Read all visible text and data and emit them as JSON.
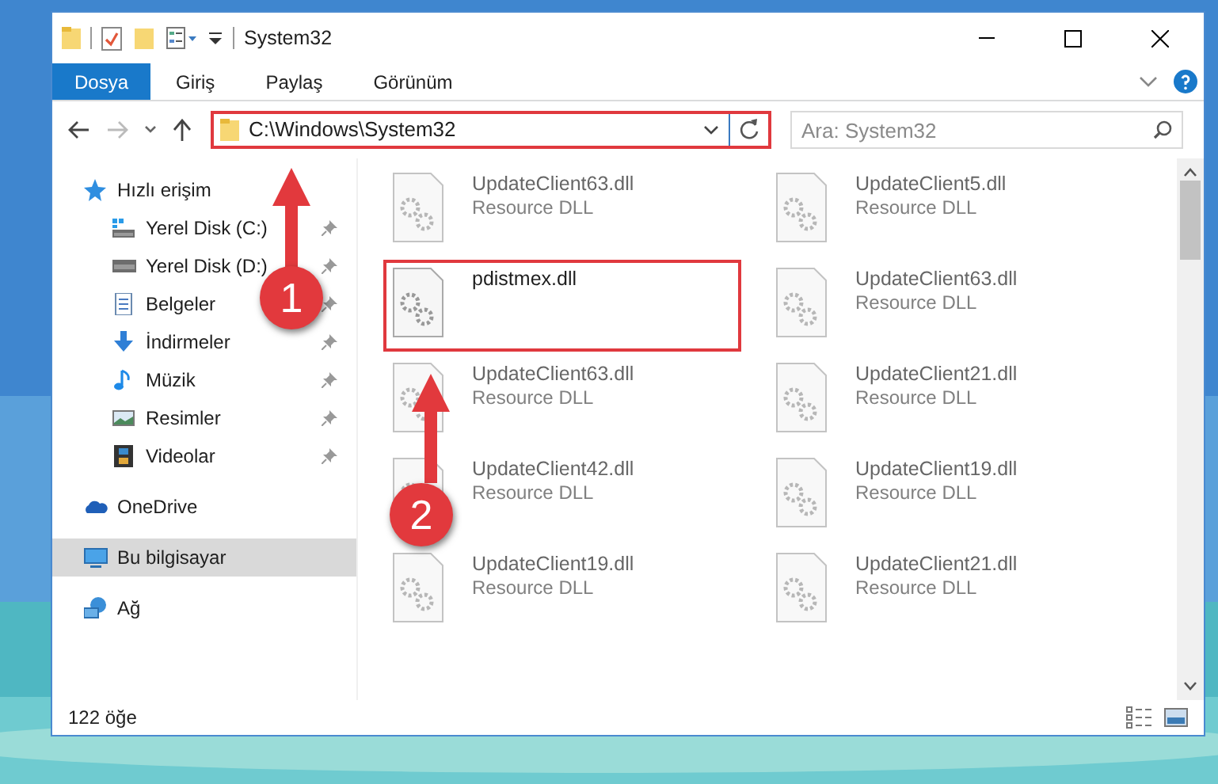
{
  "window": {
    "title": "System32"
  },
  "ribbon_tabs": [
    {
      "label": "Dosya",
      "selected": true
    },
    {
      "label": "Giriş",
      "selected": false
    },
    {
      "label": "Paylaş",
      "selected": false
    },
    {
      "label": "Görünüm",
      "selected": false
    }
  ],
  "address_bar": {
    "path": "C:\\Windows\\System32",
    "highlighted": true
  },
  "search": {
    "placeholder": "Ara: System32"
  },
  "navigation": [
    {
      "label": "Hızlı erişim",
      "kind": "star",
      "selected": false,
      "children": [
        {
          "label": "Yerel Disk (C:)",
          "kind": "system-drive",
          "pinned": true,
          "selected": false
        },
        {
          "label": "Yerel Disk (D:)",
          "kind": "drive",
          "pinned": true,
          "selected": false
        },
        {
          "label": "Belgeler",
          "kind": "documents",
          "pinned": true,
          "selected": false
        },
        {
          "label": "İndirmeler",
          "kind": "downloads",
          "pinned": true,
          "selected": false
        },
        {
          "label": "Müzik",
          "kind": "music",
          "pinned": true,
          "selected": false
        },
        {
          "label": "Resimler",
          "kind": "pictures",
          "pinned": true,
          "selected": false
        },
        {
          "label": "Videolar",
          "kind": "videos",
          "pinned": true,
          "selected": false
        }
      ]
    },
    {
      "label": "OneDrive",
      "kind": "cloud",
      "selected": false
    },
    {
      "label": "Bu bilgisayar",
      "kind": "computer",
      "selected": true
    },
    {
      "label": "Ağ",
      "kind": "network",
      "selected": false
    }
  ],
  "files": [
    {
      "name": "UpdateClient63.dll",
      "type": "Resource DLL",
      "dimmed": true,
      "highlighted": false
    },
    {
      "name": "UpdateClient5.dll",
      "type": "Resource DLL",
      "dimmed": true,
      "highlighted": false
    },
    {
      "name": "pdistmex.dll",
      "dimmed": false,
      "highlighted": true
    },
    {
      "name": "UpdateClient63.dll",
      "type": "Resource DLL",
      "dimmed": true,
      "highlighted": false
    },
    {
      "name": "UpdateClient63.dll",
      "type": "Resource DLL",
      "dimmed": true,
      "highlighted": false
    },
    {
      "name": "UpdateClient21.dll",
      "type": "Resource DLL",
      "dimmed": true,
      "highlighted": false
    },
    {
      "name": "UpdateClient42.dll",
      "type": "Resource DLL",
      "dimmed": true,
      "highlighted": false
    },
    {
      "name": "UpdateClient19.dll",
      "type": "Resource DLL",
      "dimmed": true,
      "highlighted": false
    },
    {
      "name": "UpdateClient19.dll",
      "type": "Resource DLL",
      "dimmed": true,
      "highlighted": false
    },
    {
      "name": "UpdateClient21.dll",
      "type": "Resource DLL",
      "dimmed": true,
      "highlighted": false
    }
  ],
  "status_bar": {
    "item_count": "122 öğe"
  },
  "annotations": [
    {
      "label": "1"
    },
    {
      "label": "2"
    }
  ]
}
